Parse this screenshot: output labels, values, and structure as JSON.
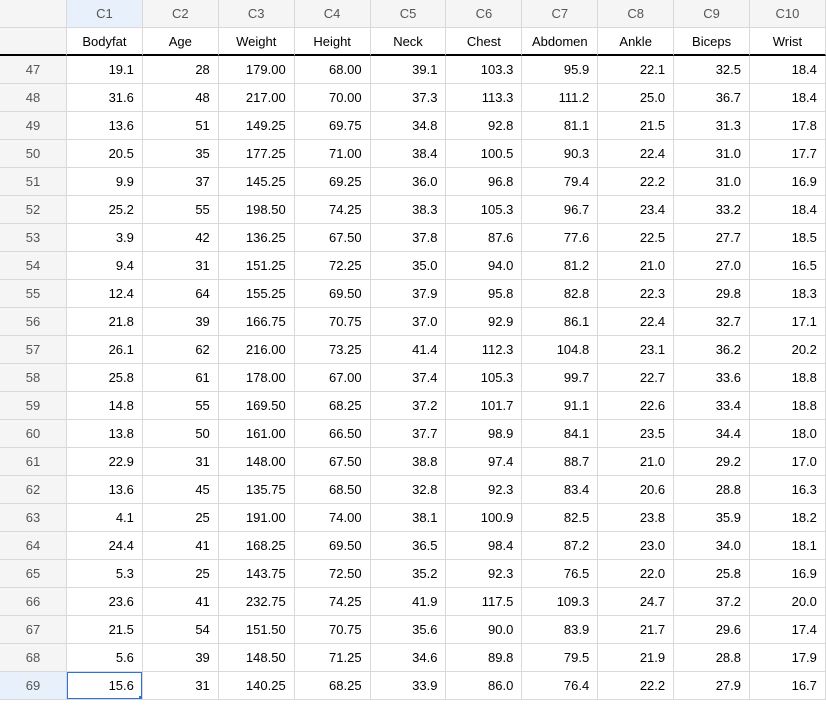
{
  "chart_data": {
    "type": "table",
    "columns": [
      "C1",
      "C2",
      "C3",
      "C4",
      "C5",
      "C6",
      "C7",
      "C8",
      "C9",
      "C10"
    ],
    "column_labels": [
      "Bodyfat",
      "Age",
      "Weight",
      "Height",
      "Neck",
      "Chest",
      "Abdomen",
      "Ankle",
      "Biceps",
      "Wrist"
    ],
    "row_ids": [
      "47",
      "48",
      "49",
      "50",
      "51",
      "52",
      "53",
      "54",
      "55",
      "56",
      "57",
      "58",
      "59",
      "60",
      "61",
      "62",
      "63",
      "64",
      "65",
      "66",
      "67",
      "68",
      "69"
    ],
    "rows": [
      [
        "19.1",
        "28",
        "179.00",
        "68.00",
        "39.1",
        "103.3",
        "95.9",
        "22.1",
        "32.5",
        "18.4"
      ],
      [
        "31.6",
        "48",
        "217.00",
        "70.00",
        "37.3",
        "113.3",
        "111.2",
        "25.0",
        "36.7",
        "18.4"
      ],
      [
        "13.6",
        "51",
        "149.25",
        "69.75",
        "34.8",
        "92.8",
        "81.1",
        "21.5",
        "31.3",
        "17.8"
      ],
      [
        "20.5",
        "35",
        "177.25",
        "71.00",
        "38.4",
        "100.5",
        "90.3",
        "22.4",
        "31.0",
        "17.7"
      ],
      [
        "9.9",
        "37",
        "145.25",
        "69.25",
        "36.0",
        "96.8",
        "79.4",
        "22.2",
        "31.0",
        "16.9"
      ],
      [
        "25.2",
        "55",
        "198.50",
        "74.25",
        "38.3",
        "105.3",
        "96.7",
        "23.4",
        "33.2",
        "18.4"
      ],
      [
        "3.9",
        "42",
        "136.25",
        "67.50",
        "37.8",
        "87.6",
        "77.6",
        "22.5",
        "27.7",
        "18.5"
      ],
      [
        "9.4",
        "31",
        "151.25",
        "72.25",
        "35.0",
        "94.0",
        "81.2",
        "21.0",
        "27.0",
        "16.5"
      ],
      [
        "12.4",
        "64",
        "155.25",
        "69.50",
        "37.9",
        "95.8",
        "82.8",
        "22.3",
        "29.8",
        "18.3"
      ],
      [
        "21.8",
        "39",
        "166.75",
        "70.75",
        "37.0",
        "92.9",
        "86.1",
        "22.4",
        "32.7",
        "17.1"
      ],
      [
        "26.1",
        "62",
        "216.00",
        "73.25",
        "41.4",
        "112.3",
        "104.8",
        "23.1",
        "36.2",
        "20.2"
      ],
      [
        "25.8",
        "61",
        "178.00",
        "67.00",
        "37.4",
        "105.3",
        "99.7",
        "22.7",
        "33.6",
        "18.8"
      ],
      [
        "14.8",
        "55",
        "169.50",
        "68.25",
        "37.2",
        "101.7",
        "91.1",
        "22.6",
        "33.4",
        "18.8"
      ],
      [
        "13.8",
        "50",
        "161.00",
        "66.50",
        "37.7",
        "98.9",
        "84.1",
        "23.5",
        "34.4",
        "18.0"
      ],
      [
        "22.9",
        "31",
        "148.00",
        "67.50",
        "38.8",
        "97.4",
        "88.7",
        "21.0",
        "29.2",
        "17.0"
      ],
      [
        "13.6",
        "45",
        "135.75",
        "68.50",
        "32.8",
        "92.3",
        "83.4",
        "20.6",
        "28.8",
        "16.3"
      ],
      [
        "4.1",
        "25",
        "191.00",
        "74.00",
        "38.1",
        "100.9",
        "82.5",
        "23.8",
        "35.9",
        "18.2"
      ],
      [
        "24.4",
        "41",
        "168.25",
        "69.50",
        "36.5",
        "98.4",
        "87.2",
        "23.0",
        "34.0",
        "18.1"
      ],
      [
        "5.3",
        "25",
        "143.75",
        "72.50",
        "35.2",
        "92.3",
        "76.5",
        "22.0",
        "25.8",
        "16.9"
      ],
      [
        "23.6",
        "41",
        "232.75",
        "74.25",
        "41.9",
        "117.5",
        "109.3",
        "24.7",
        "37.2",
        "20.0"
      ],
      [
        "21.5",
        "54",
        "151.50",
        "70.75",
        "35.6",
        "90.0",
        "83.9",
        "21.7",
        "29.6",
        "17.4"
      ],
      [
        "5.6",
        "39",
        "148.50",
        "71.25",
        "34.6",
        "89.8",
        "79.5",
        "21.9",
        "28.8",
        "17.9"
      ],
      [
        "15.6",
        "31",
        "140.25",
        "68.25",
        "33.9",
        "86.0",
        "76.4",
        "22.2",
        "27.9",
        "16.7"
      ]
    ]
  },
  "selection": {
    "row": 22,
    "col": 0
  }
}
